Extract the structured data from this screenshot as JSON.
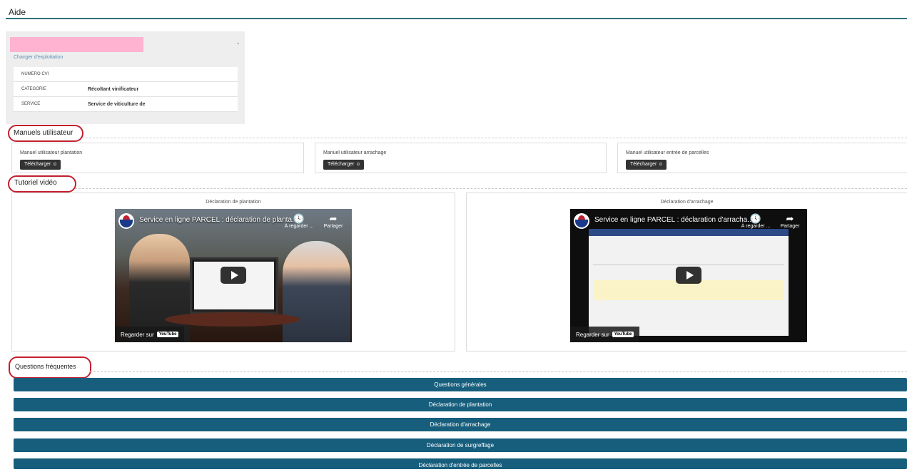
{
  "page": {
    "title": "Aide"
  },
  "exploitation": {
    "change_link": "Changer d'exploitation",
    "dash": "-",
    "rows": [
      {
        "label": "NUMERO CVI",
        "value": ""
      },
      {
        "label": "CATEGORIE",
        "value": "Récoltant vinificateur"
      },
      {
        "label": "SERVICE",
        "value": "Service de viticulture de"
      }
    ]
  },
  "manuals": {
    "heading": "Manuels utilisateur",
    "download_label": "Télécharger",
    "items": [
      {
        "title": "Manuel utilisateur plantation"
      },
      {
        "title": "Manuel utilisateur arrachage"
      },
      {
        "title": "Manuel utilisateur entrée de parcelles"
      }
    ]
  },
  "videos": {
    "heading": "Tutoriel vidéo",
    "watch_later": "À regarder ...",
    "share": "Partager",
    "watch_on": "Regarder sur",
    "yt": "YouTube",
    "items": [
      {
        "title": "Déclaration de plantation",
        "overlay": "Service en ligne PARCEL : déclaration de planta..."
      },
      {
        "title": "Déclaration d'arrachage",
        "overlay": "Service en ligne PARCEL : déclaration d'arracha..."
      }
    ]
  },
  "faq": {
    "heading": "Questions fréquentes",
    "items": [
      "Questions générales",
      "Déclaration de plantation",
      "Déclaration d'arrachage",
      "Déclaration de surgreffage",
      "Déclaration d'entrée de parcelles"
    ]
  },
  "colors": {
    "accent": "#175e7d",
    "highlight_ring": "#c3202f",
    "redaction": "#ffb3d0"
  }
}
